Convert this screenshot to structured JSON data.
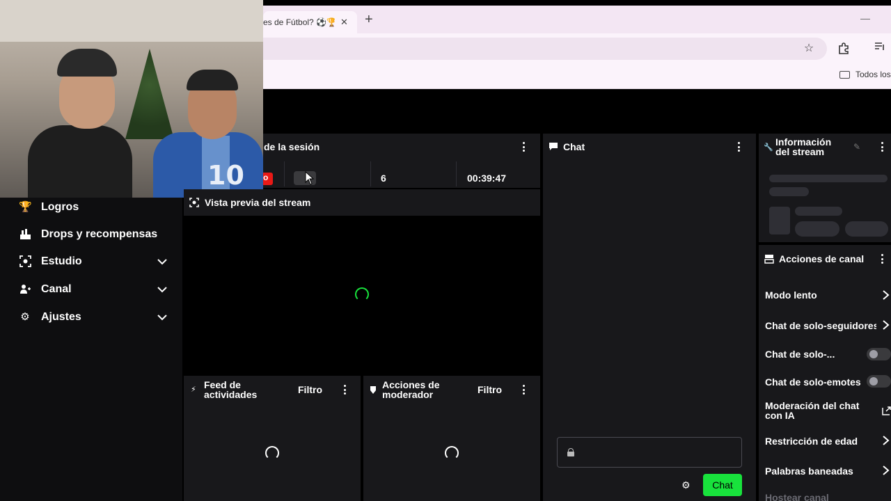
{
  "browser": {
    "tab_title": "es de Fútbol? ⚽🏆",
    "tab_close": "✕",
    "new_tab": "+",
    "minimize": "—",
    "bookmarks_folder": "Todos los"
  },
  "sidebar": {
    "items": [
      {
        "label": "Logros",
        "icon": "trophy-icon",
        "glyph": "🏆",
        "expandable": false
      },
      {
        "label": "Drops y recompensas",
        "icon": "gift-icon",
        "glyph": "▙",
        "expandable": false
      },
      {
        "label": "Estudio",
        "icon": "studio-icon",
        "glyph": "◙",
        "expandable": true
      },
      {
        "label": "Canal",
        "icon": "channel-icon",
        "glyph": "⚇",
        "expandable": true
      },
      {
        "label": "Ajustes",
        "icon": "gear-icon",
        "glyph": "⚙",
        "expandable": true
      }
    ]
  },
  "session": {
    "title": "de la sesión",
    "live_partial": "o",
    "viewers": "6",
    "duration": "00:39:47"
  },
  "preview": {
    "title": "Vista previa del stream",
    "icon": "camera-icon"
  },
  "activity_feed": {
    "title_line1": "Feed de",
    "title_line2": "actividades",
    "filter": "Filtro"
  },
  "mod_actions": {
    "title_line1": "Acciones de",
    "title_line2": "moderador",
    "filter": "Filtro"
  },
  "chat": {
    "title": "Chat",
    "send_label": "Chat",
    "accent": "#18e23c"
  },
  "stream_info": {
    "title_line1": "Información",
    "title_line2": "del stream"
  },
  "channel_actions": {
    "title": "Acciones de canal",
    "items": [
      {
        "label": "Modo lento",
        "control": "chevron"
      },
      {
        "label": "Chat de solo-seguidores",
        "control": "chevron"
      },
      {
        "label": "Chat de solo-...",
        "control": "toggle",
        "on": false
      },
      {
        "label": "Chat de solo-emotes",
        "control": "toggle",
        "on": false
      },
      {
        "label": "Moderación del chat con IA",
        "control": "external"
      },
      {
        "label": "Restricción de edad",
        "control": "chevron"
      },
      {
        "label": "Palabras baneadas",
        "control": "chevron"
      },
      {
        "label": "Hostear canal",
        "control": "none"
      }
    ]
  },
  "webcam": {
    "jersey_number": "10"
  }
}
